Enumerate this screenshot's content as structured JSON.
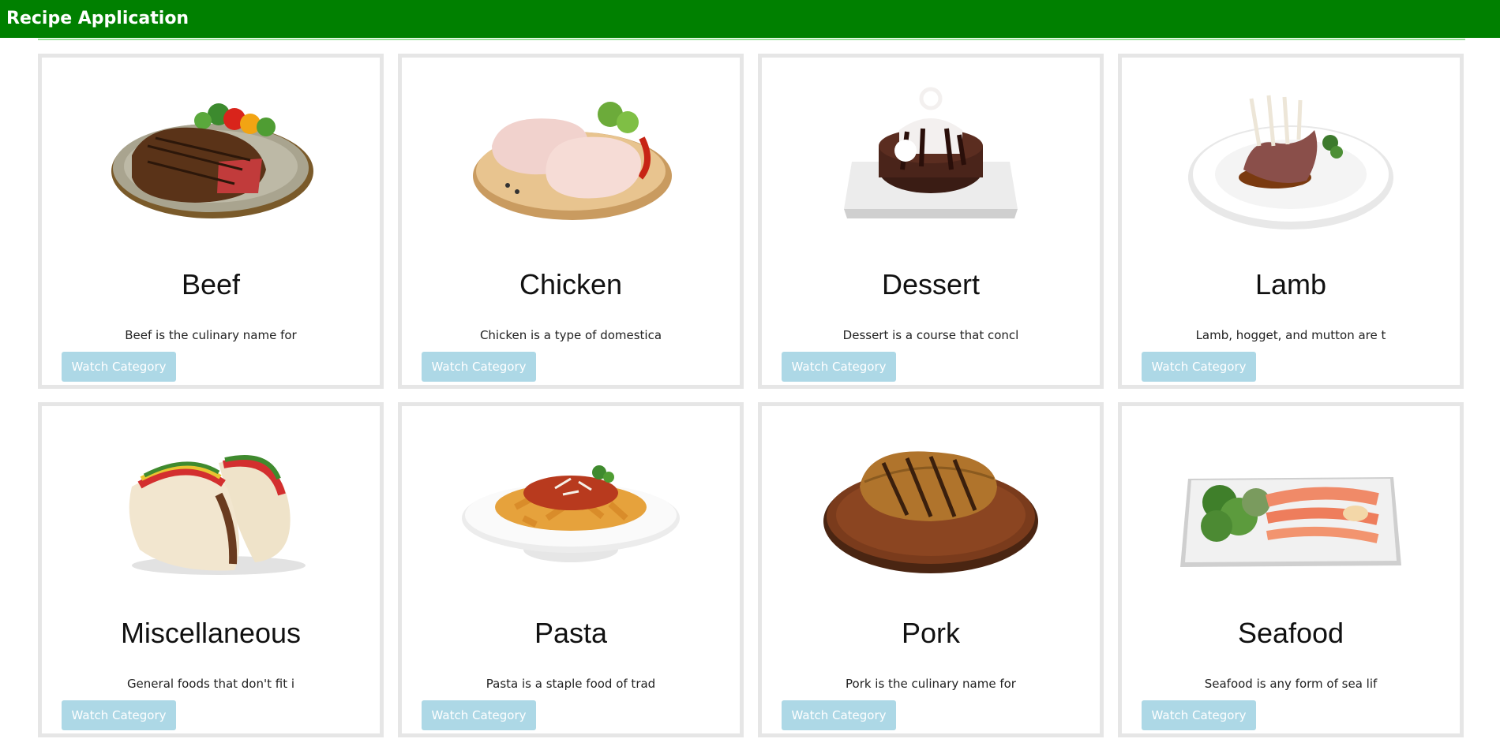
{
  "header": {
    "title": "Recipe Application"
  },
  "colors": {
    "header_bg": "#008000",
    "button_bg": "#add8e6",
    "card_border": "#e6e6e6"
  },
  "categories": [
    {
      "name": "Beef",
      "description": "Beef is the culinary name for",
      "button_label": "Watch Category",
      "icon": "steak-plate-image"
    },
    {
      "name": "Chicken",
      "description": "Chicken is a type of domestica",
      "button_label": "Watch Category",
      "icon": "raw-chicken-image"
    },
    {
      "name": "Dessert",
      "description": "Dessert is a course that concl",
      "button_label": "Watch Category",
      "icon": "chocolate-cake-image"
    },
    {
      "name": "Lamb",
      "description": "Lamb, hogget, and mutton are t",
      "button_label": "Watch Category",
      "icon": "lamb-rack-image"
    },
    {
      "name": "Miscellaneous",
      "description": "General foods that don't fit i",
      "button_label": "Watch Category",
      "icon": "tacos-image"
    },
    {
      "name": "Pasta",
      "description": "Pasta is a staple food of trad",
      "button_label": "Watch Category",
      "icon": "penne-bowl-image"
    },
    {
      "name": "Pork",
      "description": "Pork is the culinary name for",
      "button_label": "Watch Category",
      "icon": "pork-chop-board-image"
    },
    {
      "name": "Seafood",
      "description": "Seafood is any form of sea lif",
      "button_label": "Watch Category",
      "icon": "salmon-platter-image"
    }
  ]
}
